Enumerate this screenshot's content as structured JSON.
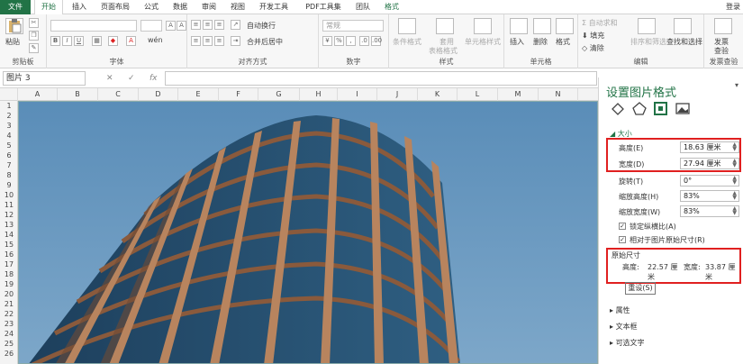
{
  "tabs": [
    "文件",
    "开始",
    "插入",
    "页面布局",
    "公式",
    "数据",
    "审阅",
    "视图",
    "开发工具",
    "PDF工具集",
    "团队",
    "格式"
  ],
  "login": "登录",
  "ribbon": {
    "clipboard": {
      "paste": "粘贴",
      "label": "剪贴板"
    },
    "font": {
      "label": "字体",
      "bold": "B",
      "italic": "I",
      "underline": "U",
      "wen": "wén"
    },
    "alignment": {
      "wrap": "自动换行",
      "merge": "合并后居中",
      "label": "对齐方式"
    },
    "number": {
      "format_value": "常规",
      "label": "数字"
    },
    "styles": {
      "cond": "条件格式",
      "table1": "套用",
      "table2": "表格格式",
      "cell": "单元格样式",
      "label": "样式"
    },
    "cells": {
      "insert": "插入",
      "delete": "删除",
      "format": "格式",
      "label": "单元格"
    },
    "editing": {
      "autosum": "自动求和",
      "fill": "填充",
      "clear": "清除",
      "sort": "排序和筛选",
      "find": "查找和选择",
      "label": "编辑"
    },
    "invoice": {
      "btn1": "发票",
      "btn2": "查验",
      "label": "发票查验"
    }
  },
  "formula_bar": {
    "name_box": "图片 3",
    "fx": "fx"
  },
  "columns": [
    "A",
    "B",
    "C",
    "D",
    "E",
    "F",
    "G",
    "H",
    "I",
    "J",
    "K",
    "L",
    "M",
    "N"
  ],
  "rows": [
    "1",
    "2",
    "3",
    "4",
    "5",
    "6",
    "7",
    "8",
    "9",
    "10",
    "11",
    "12",
    "13",
    "14",
    "15",
    "16",
    "17",
    "18",
    "19",
    "20",
    "21",
    "22",
    "23",
    "24",
    "25",
    "26"
  ],
  "pane": {
    "title": "设置图片格式",
    "close": "▾",
    "section_size": "大小",
    "height_label": "高度(E)",
    "height_value": "18.63 厘米",
    "width_label": "宽度(D)",
    "width_value": "27.94 厘米",
    "rotate_label": "旋转(T)",
    "rotate_value": "0°",
    "scale_h_label": "缩放高度(H)",
    "scale_h_value": "83%",
    "scale_w_label": "缩放宽度(W)",
    "scale_w_value": "83%",
    "lock_aspect": "锁定纵横比(A)",
    "relative_original": "相对于图片原始尺寸(R)",
    "original_size": "原始尺寸",
    "orig_height_label": "高度:",
    "orig_height_value": "22.57 厘米",
    "orig_width_label": "宽度:",
    "orig_width_value": "33.87 厘米",
    "reset": "重设(S)",
    "section_props": "属性",
    "section_textbox": "文本框",
    "section_alt": "可选文字"
  },
  "colors": {
    "accent": "#217346",
    "highlight": "#e02020",
    "sky": "#5f93bd"
  }
}
